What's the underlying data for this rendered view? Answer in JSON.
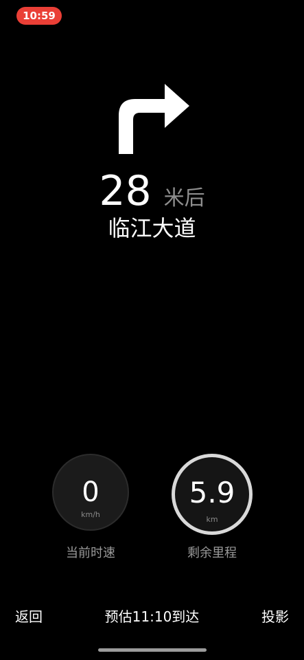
{
  "status_bar": {
    "time": "10:59"
  },
  "navigation": {
    "turn_icon": "turn-right-arrow",
    "distance_value": "28",
    "distance_unit": "米后",
    "road_name": "临江大道"
  },
  "gauges": {
    "speed": {
      "value": "0",
      "unit": "km/h",
      "label": "当前时速"
    },
    "remaining": {
      "value": "5.9",
      "unit": "km",
      "label": "剩余里程"
    }
  },
  "bottom_bar": {
    "back_label": "返回",
    "eta_label": "预估11:10到达",
    "project_label": "投影"
  },
  "colors": {
    "background": "#000000",
    "status_pill": "#ea3f36",
    "primary_text": "#ffffff",
    "secondary_text": "#8e8e8e"
  }
}
